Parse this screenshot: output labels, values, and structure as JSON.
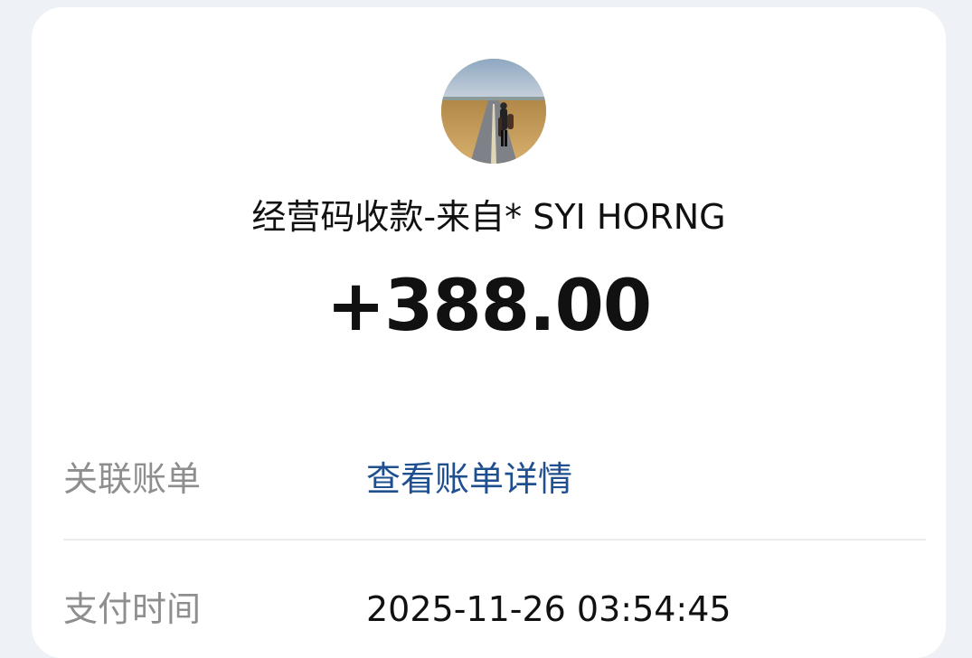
{
  "transaction": {
    "title": "经营码收款-来自* SYI HORNG",
    "amount": "+388.00"
  },
  "details": {
    "bill": {
      "label": "关联账单",
      "link_text": "查看账单详情"
    },
    "payment_time": {
      "label": "支付时间",
      "value": "2025-11-26 03:54:45"
    }
  },
  "colors": {
    "page_bg": "#eef2f7",
    "card_bg": "#ffffff",
    "text_primary": "#111111",
    "text_secondary": "#8e8e8e",
    "link": "#1f4f8f",
    "divider": "#ececec"
  }
}
